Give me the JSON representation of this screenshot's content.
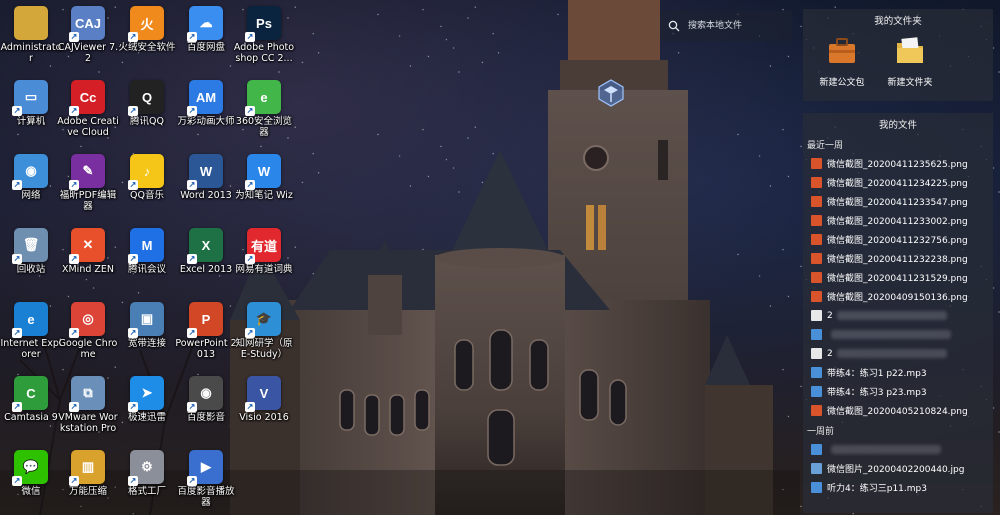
{
  "desktop": {
    "icons": [
      {
        "label": "Administrator",
        "glyph": "",
        "color": "#d4a73a",
        "icon": "folder-icon"
      },
      {
        "label": "CAJViewer 7.2",
        "glyph": "CAJ",
        "color": "#5b7fc4",
        "icon": "cajviewer-icon"
      },
      {
        "label": "火绒安全软件",
        "glyph": "火",
        "color": "#f08a1c",
        "icon": "huorong-icon"
      },
      {
        "label": "百度网盘",
        "glyph": "☁",
        "color": "#3a8ef0",
        "icon": "baidu-netdisk-icon"
      },
      {
        "label": "Adobe Photoshop CC 2...",
        "glyph": "Ps",
        "color": "#0a2440",
        "icon": "photoshop-icon"
      },
      {
        "label": "计算机",
        "glyph": "▭",
        "color": "#4b8cd6",
        "icon": "computer-icon"
      },
      {
        "label": "Adobe Creative Cloud",
        "glyph": "Cc",
        "color": "#d41f26",
        "icon": "creative-cloud-icon"
      },
      {
        "label": "腾讯QQ",
        "glyph": "Q",
        "color": "#222222",
        "icon": "qq-icon"
      },
      {
        "label": "万彩动画大师",
        "glyph": "AM",
        "color": "#2c7be5",
        "icon": "animiz-icon"
      },
      {
        "label": "360安全浏览器",
        "glyph": "e",
        "color": "#43b649",
        "icon": "360-browser-icon"
      },
      {
        "label": "网络",
        "glyph": "◉",
        "color": "#3d8fd9",
        "icon": "network-icon"
      },
      {
        "label": "福昕PDF编辑器",
        "glyph": "✎",
        "color": "#7a2fa0",
        "icon": "foxit-pdf-icon"
      },
      {
        "label": "QQ音乐",
        "glyph": "♪",
        "color": "#f5c518",
        "icon": "qq-music-icon"
      },
      {
        "label": "Word 2013",
        "glyph": "W",
        "color": "#2b5797",
        "icon": "word-icon"
      },
      {
        "label": "为知笔记 Wiz",
        "glyph": "W",
        "color": "#2a86e8",
        "icon": "wiznote-icon"
      },
      {
        "label": "回收站",
        "glyph": "🗑",
        "color": "#6f8fb0",
        "icon": "recycle-bin-icon"
      },
      {
        "label": "XMind ZEN",
        "glyph": "✕",
        "color": "#e8502b",
        "icon": "xmind-icon"
      },
      {
        "label": "腾讯会议",
        "glyph": "M",
        "color": "#1f6fe5",
        "icon": "tencent-meeting-icon"
      },
      {
        "label": "Excel 2013",
        "glyph": "X",
        "color": "#1e7145",
        "icon": "excel-icon"
      },
      {
        "label": "网易有道词典",
        "glyph": "有道",
        "color": "#e0282e",
        "icon": "youdao-dict-icon"
      },
      {
        "label": "Internet Explorer",
        "glyph": "e",
        "color": "#1a80d4",
        "icon": "internet-explorer-icon"
      },
      {
        "label": "Google Chrome",
        "glyph": "◎",
        "color": "#db4437",
        "icon": "chrome-icon"
      },
      {
        "label": "宽带连接",
        "glyph": "▣",
        "color": "#4a7fb5",
        "icon": "broadband-icon"
      },
      {
        "label": "PowerPoint 2013",
        "glyph": "P",
        "color": "#d24726",
        "icon": "powerpoint-icon"
      },
      {
        "label": "知网研学（原E-Study）",
        "glyph": "🎓",
        "color": "#2d8fd5",
        "icon": "cnki-estudy-icon"
      },
      {
        "label": "Camtasia 9",
        "glyph": "C",
        "color": "#2e9c3a",
        "icon": "camtasia-icon"
      },
      {
        "label": "VMware Workstation Pro",
        "glyph": "⧉",
        "color": "#6a8fb8",
        "icon": "vmware-icon"
      },
      {
        "label": "极速迅雷",
        "glyph": "➤",
        "color": "#1d8de8",
        "icon": "xunlei-icon"
      },
      {
        "label": "百度影音",
        "glyph": "◉",
        "color": "#4a4a4a",
        "icon": "baidu-player-icon"
      },
      {
        "label": "Visio 2016",
        "glyph": "V",
        "color": "#3955a3",
        "icon": "visio-icon"
      },
      {
        "label": "微信",
        "glyph": "💬",
        "color": "#2dc100",
        "icon": "wechat-icon"
      },
      {
        "label": "万能压缩",
        "glyph": "▥",
        "color": "#d9a22c",
        "icon": "compress-icon"
      },
      {
        "label": "格式工厂",
        "glyph": "⚙",
        "color": "#8a8f99",
        "icon": "format-factory-icon"
      },
      {
        "label": "百度影音播放器",
        "glyph": "▶",
        "color": "#3a6fd0",
        "icon": "media-player-icon"
      }
    ]
  },
  "search": {
    "placeholder": "搜索本地文件"
  },
  "fence_files": {
    "title": "我的文件夹",
    "items": [
      {
        "label": "新建公文包",
        "icon": "briefcase-icon"
      },
      {
        "label": "新建文件夹",
        "icon": "folder-icon"
      }
    ]
  },
  "fence_myfiles": {
    "title": "我的文件",
    "groups": [
      {
        "header": "最近一周",
        "files": [
          {
            "name": "微信截图_20200411235625.png",
            "icon": "png-icon",
            "color": "#d9532b"
          },
          {
            "name": "微信截图_20200411234225.png",
            "icon": "png-icon",
            "color": "#d9532b"
          },
          {
            "name": "微信截图_20200411233547.png",
            "icon": "png-icon",
            "color": "#d9532b"
          },
          {
            "name": "微信截图_20200411233002.png",
            "icon": "png-icon",
            "color": "#d9532b"
          },
          {
            "name": "微信截图_20200411232756.png",
            "icon": "png-icon",
            "color": "#d9532b"
          },
          {
            "name": "微信截图_20200411232238.png",
            "icon": "png-icon",
            "color": "#d9532b"
          },
          {
            "name": "微信截图_20200411231529.png",
            "icon": "png-icon",
            "color": "#d9532b"
          },
          {
            "name": "微信截图_20200409150136.png",
            "icon": "png-icon",
            "color": "#d9532b"
          },
          {
            "name": "2",
            "icon": "doc-icon",
            "color": "#e8e8e8",
            "blurred": true
          },
          {
            "name": "",
            "icon": "audio-icon",
            "color": "#4a90d9",
            "blurred": true
          },
          {
            "name": "2",
            "icon": "doc-icon",
            "color": "#e8e8e8",
            "blurred": true
          },
          {
            "name": "带练4：练习1 p22.mp3",
            "icon": "audio-icon",
            "color": "#4a90d9"
          },
          {
            "name": "带练4：练习3 p23.mp3",
            "icon": "audio-icon",
            "color": "#4a90d9"
          },
          {
            "name": "微信截图_20200405210824.png",
            "icon": "png-icon",
            "color": "#d9532b"
          }
        ]
      },
      {
        "header": "一周前",
        "files": [
          {
            "name": "",
            "icon": "audio-icon",
            "color": "#4a90d9",
            "blurred": true
          },
          {
            "name": "微信图片_20200402200440.jpg",
            "icon": "jpg-icon",
            "color": "#6aa0d8"
          },
          {
            "name": "听力4：练习三p11.mp3",
            "icon": "audio-icon",
            "color": "#4a90d9"
          }
        ]
      }
    ]
  }
}
